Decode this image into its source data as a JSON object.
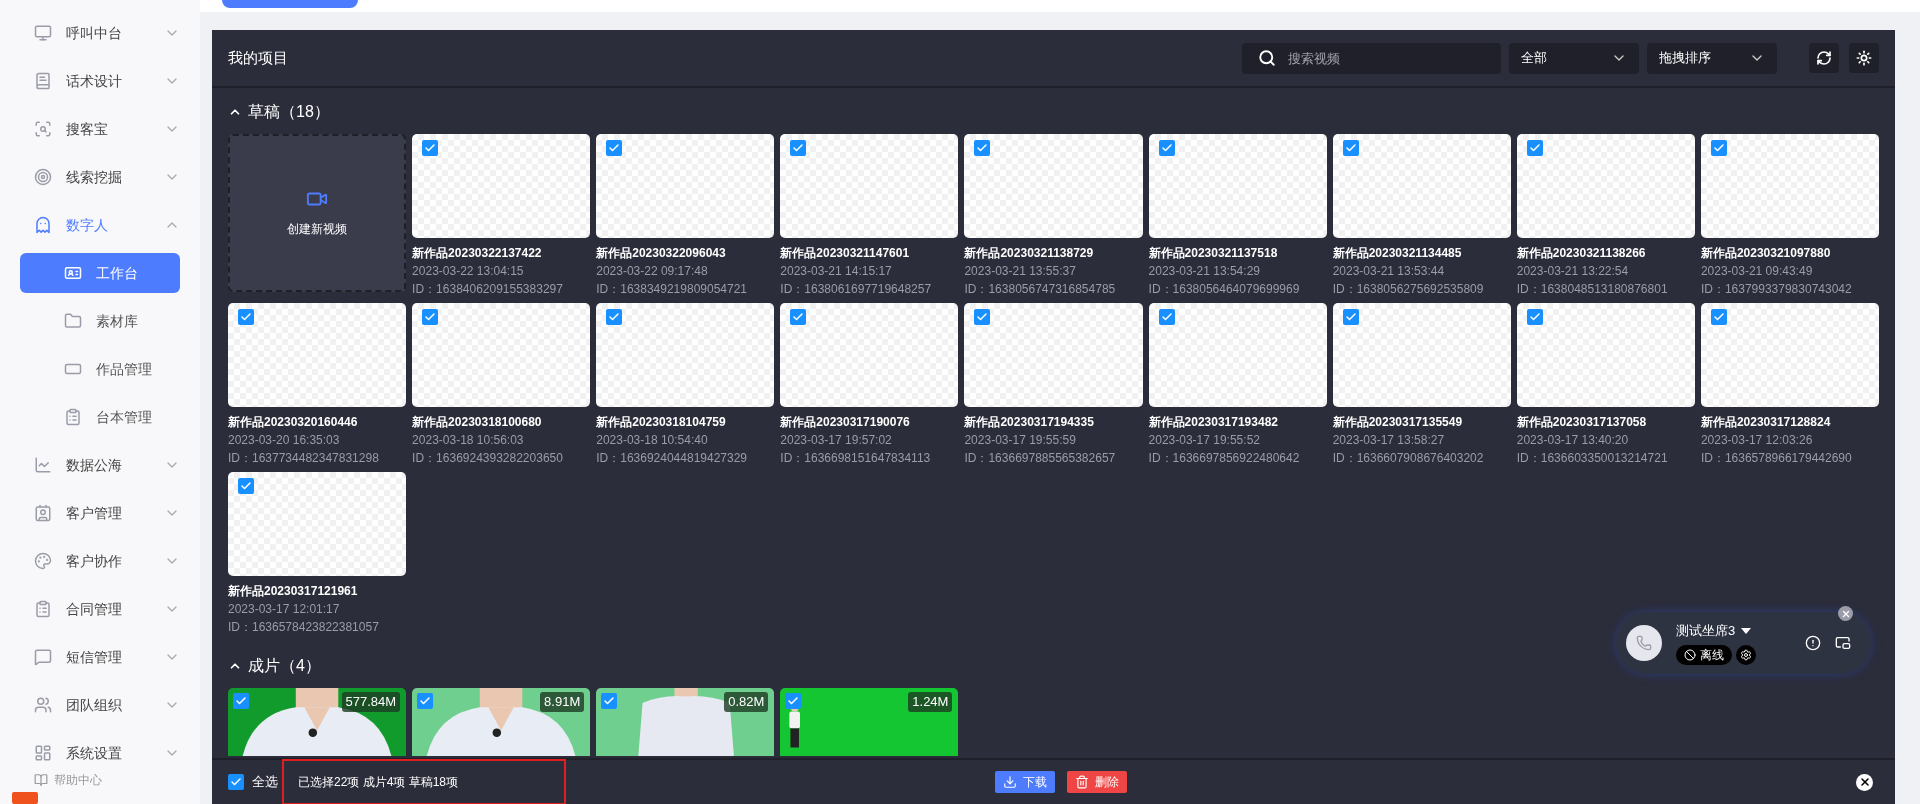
{
  "sidebar": {
    "items": [
      {
        "label": "呼叫中台",
        "selected": false,
        "expanded": false
      },
      {
        "label": "话术设计",
        "selected": false,
        "expanded": false
      },
      {
        "label": "搜客宝",
        "selected": false,
        "expanded": false
      },
      {
        "label": "线索挖掘",
        "selected": false,
        "expanded": false
      },
      {
        "label": "数字人",
        "selected": true,
        "expanded": true,
        "children": [
          {
            "label": "工作台",
            "selected": true
          },
          {
            "label": "素材库",
            "selected": false
          },
          {
            "label": "作品管理",
            "selected": false
          },
          {
            "label": "台本管理",
            "selected": false
          }
        ]
      },
      {
        "label": "数据公海",
        "selected": false,
        "expanded": false
      },
      {
        "label": "客户管理",
        "selected": false,
        "expanded": false
      },
      {
        "label": "客户协作",
        "selected": false,
        "expanded": false
      },
      {
        "label": "合同管理",
        "selected": false,
        "expanded": false
      },
      {
        "label": "短信管理",
        "selected": false,
        "expanded": false
      },
      {
        "label": "团队组织",
        "selected": false,
        "expanded": false
      },
      {
        "label": "系统设置",
        "selected": false,
        "expanded": false
      }
    ],
    "help": "帮助中心"
  },
  "panel": {
    "title": "我的项目",
    "search": {
      "placeholder": "搜索视频"
    },
    "filters": [
      "全部",
      "拖拽排序"
    ]
  },
  "sections": [
    {
      "title": "草稿",
      "count": "（18）",
      "expanded": true,
      "create_label": "创建新视频",
      "items": [
        {
          "name": "新作品20230322137422",
          "date": "2023-03-22 13:04:15",
          "id": "ID：1638406209155383297",
          "checked": true
        },
        {
          "name": "新作品20230322096043",
          "date": "2023-03-22 09:17:48",
          "id": "ID：1638349219809054721",
          "checked": true
        },
        {
          "name": "新作品20230321147601",
          "date": "2023-03-21 14:15:17",
          "id": "ID：1638061697719648257",
          "checked": true
        },
        {
          "name": "新作品20230321138729",
          "date": "2023-03-21 13:55:37",
          "id": "ID：1638056747316854785",
          "checked": true
        },
        {
          "name": "新作品20230321137518",
          "date": "2023-03-21 13:54:29",
          "id": "ID：1638056464079699969",
          "checked": true
        },
        {
          "name": "新作品20230321134485",
          "date": "2023-03-21 13:53:44",
          "id": "ID：1638056275692535809",
          "checked": true
        },
        {
          "name": "新作品20230321138266",
          "date": "2023-03-21 13:22:54",
          "id": "ID：1638048513180876801",
          "checked": true
        },
        {
          "name": "新作品20230321097880",
          "date": "2023-03-21 09:43:49",
          "id": "ID：1637993379830743042",
          "checked": true
        },
        {
          "name": "新作品20230320160446",
          "date": "2023-03-20 16:35:03",
          "id": "ID：1637734482347831298",
          "checked": true
        },
        {
          "name": "新作品20230318100680",
          "date": "2023-03-18 10:56:03",
          "id": "ID：1636924393282203650",
          "checked": true
        },
        {
          "name": "新作品20230318104759",
          "date": "2023-03-18 10:54:40",
          "id": "ID：1636924044819427329",
          "checked": true
        },
        {
          "name": "新作品20230317190076",
          "date": "2023-03-17 19:57:02",
          "id": "ID：1636698151647834113",
          "checked": true
        },
        {
          "name": "新作品20230317194335",
          "date": "2023-03-17 19:55:59",
          "id": "ID：1636697885565382657",
          "checked": true
        },
        {
          "name": "新作品20230317193482",
          "date": "2023-03-17 19:55:52",
          "id": "ID：1636697856922480642",
          "checked": true
        },
        {
          "name": "新作品20230317135549",
          "date": "2023-03-17 13:58:27",
          "id": "ID：1636607908676403202",
          "checked": true
        },
        {
          "name": "新作品20230317137058",
          "date": "2023-03-17 13:40:20",
          "id": "ID：1636603350013214721",
          "checked": true
        },
        {
          "name": "新作品20230317128824",
          "date": "2023-03-17 12:03:26",
          "id": "ID：1636578966179442690",
          "checked": true
        },
        {
          "name": "新作品20230317121961",
          "date": "2023-03-17 12:01:17",
          "id": "ID：1636578423822381057",
          "checked": true
        }
      ]
    },
    {
      "title": "成片",
      "count": "（4）",
      "expanded": true,
      "items": [
        {
          "size": "577.84M",
          "checked": true,
          "kind": "picture"
        },
        {
          "size": "8.91M",
          "checked": true,
          "kind": "picture"
        },
        {
          "size": "0.82M",
          "checked": true,
          "kind": "picture"
        },
        {
          "size": "1.24M",
          "checked": true,
          "kind": "picture"
        }
      ]
    }
  ],
  "agent_widget": {
    "name": "测试坐席3",
    "status": "离线"
  },
  "bottom_bar": {
    "select_all": {
      "label": "全选",
      "checked": true
    },
    "summary": "已选择22项 成片4项 草稿18项",
    "buttons": [
      {
        "label": "下载",
        "kind": "download"
      },
      {
        "label": "删除",
        "kind": "delete"
      }
    ]
  }
}
